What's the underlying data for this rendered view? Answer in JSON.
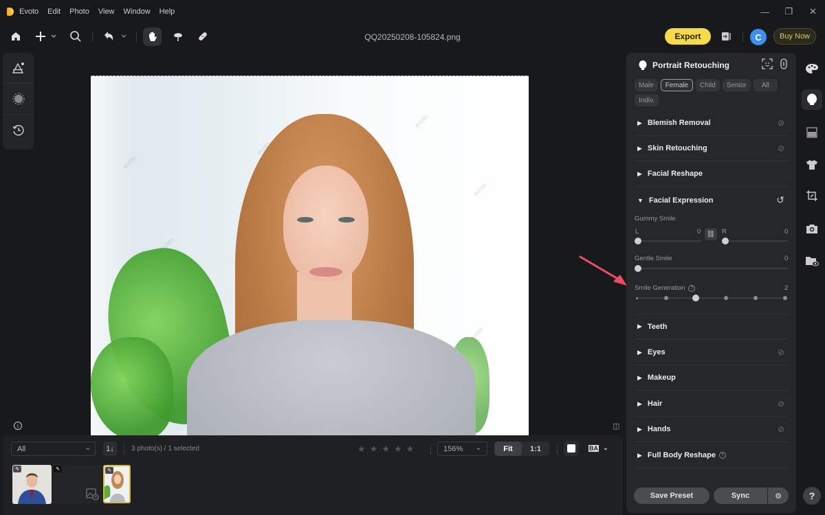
{
  "app": {
    "name": "Evoto",
    "menu": [
      "Evoto",
      "Edit",
      "Photo",
      "View",
      "Window",
      "Help"
    ],
    "window_controls": [
      "minimize-icon",
      "restore-icon",
      "close-icon"
    ]
  },
  "toolbar": {
    "filename": "QQ20250208-105824.png",
    "export_label": "Export",
    "avatar_letter": "C",
    "buy_label": "Buy Now",
    "tools": [
      "home-icon",
      "add-icon",
      "search-icon",
      "undo-icon",
      "hand-icon",
      "brush-icon",
      "bandage-icon"
    ],
    "active_tool": "hand-icon"
  },
  "left_tools": [
    "adjust-icon",
    "mask-icon",
    "history-icon"
  ],
  "canvas": {
    "watermark": "evoto"
  },
  "filmstrip": {
    "filter_value": "All",
    "sort_label": "1↓",
    "count_text": "3 photo(s) / 1 selected",
    "rating": 0,
    "rating_max": 5,
    "zoom_value": "156%",
    "fit_label": "Fit",
    "one_to_one_label": "1:1",
    "active_view": "Fit",
    "ba_label": "BA",
    "thumbnails": [
      {
        "name": "man-suit",
        "edited": true,
        "selected": false
      },
      {
        "name": "loading",
        "edited": true,
        "selected": false
      },
      {
        "name": "woman-portrait",
        "edited": true,
        "selected": true
      }
    ]
  },
  "panel": {
    "title": "Portrait Retouching",
    "chips": [
      {
        "label": "Male",
        "selected": false
      },
      {
        "label": "Female",
        "selected": true
      },
      {
        "label": "Child",
        "selected": false
      },
      {
        "label": "Senior",
        "selected": false
      },
      {
        "label": "All",
        "selected": false
      },
      {
        "label": "Indiv.",
        "selected": false
      }
    ],
    "sections": [
      {
        "label": "Blemish Removal",
        "expanded": false,
        "action": "erase-icon"
      },
      {
        "label": "Skin Retouching",
        "expanded": false,
        "action": "erase-icon"
      },
      {
        "label": "Facial Reshape",
        "expanded": false,
        "action": ""
      },
      {
        "label": "Facial Expression",
        "expanded": true,
        "action": "reset-icon"
      },
      {
        "label": "Teeth",
        "expanded": false,
        "action": ""
      },
      {
        "label": "Eyes",
        "expanded": false,
        "action": "erase-icon"
      },
      {
        "label": "Makeup",
        "expanded": false,
        "action": ""
      },
      {
        "label": "Hair",
        "expanded": false,
        "action": "erase-icon"
      },
      {
        "label": "Hands",
        "expanded": false,
        "action": "erase-icon"
      },
      {
        "label": "Full Body Reshape",
        "expanded": false,
        "action": "help-icon"
      }
    ],
    "facial_expression": {
      "gummy_smile": {
        "label": "Gummy Smile",
        "left_label": "L",
        "left_value": "0",
        "right_label": "R",
        "right_value": "0",
        "linked": true
      },
      "gentle_smile": {
        "label": "Gentle Smile",
        "value": "0"
      },
      "smile_generation": {
        "label": "Smile Generation",
        "value": "2",
        "steps": 6,
        "step_index": 2
      }
    },
    "save_preset_label": "Save Preset",
    "sync_label": "Sync"
  },
  "right_rail": [
    "palette-icon",
    "face-icon",
    "background-icon",
    "clothes-icon",
    "crop-icon",
    "camera-icon",
    "folder-eye-icon"
  ],
  "right_rail_active": "face-icon",
  "help_label": "?",
  "colors": {
    "accent": "#f8d948",
    "avatar": "#3d8ff2",
    "arrow": "#ef4a6a",
    "selected_thumb": "#d8b93a"
  }
}
